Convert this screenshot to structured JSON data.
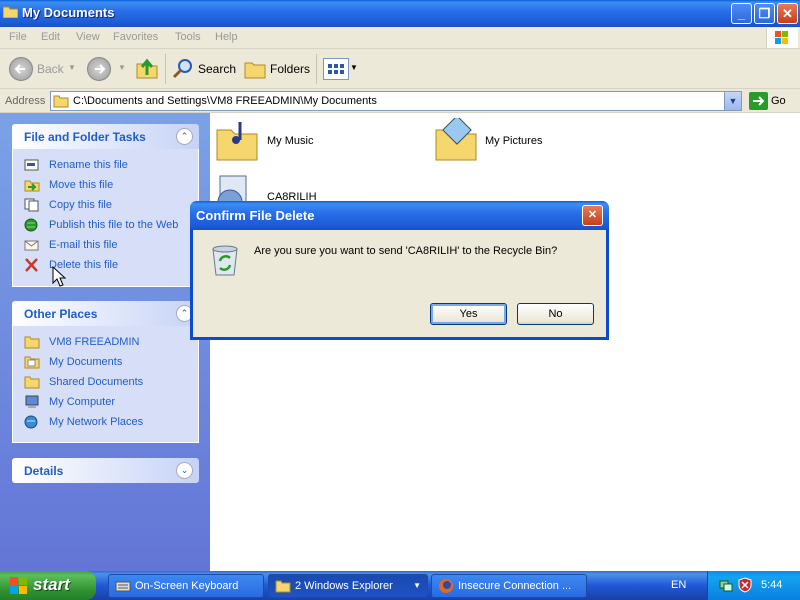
{
  "window": {
    "title": "My Documents"
  },
  "menubar": {
    "items": [
      "File",
      "Edit",
      "View",
      "Favorites",
      "Tools",
      "Help"
    ]
  },
  "toolbar": {
    "back_label": "Back",
    "search_label": "Search",
    "folders_label": "Folders"
  },
  "address": {
    "label": "Address",
    "value": "C:\\Documents and Settings\\VM8 FREEADMIN\\My Documents",
    "go_label": "Go"
  },
  "left_pane": {
    "file_tasks": {
      "title": "File and Folder Tasks",
      "items": [
        {
          "label": "Rename this file",
          "icon": "rename-icon"
        },
        {
          "label": "Move this file",
          "icon": "move-icon"
        },
        {
          "label": "Copy this file",
          "icon": "copy-icon"
        },
        {
          "label": "Publish this file to the Web",
          "icon": "publish-web-icon"
        },
        {
          "label": "E-mail this file",
          "icon": "email-icon"
        },
        {
          "label": "Delete this file",
          "icon": "delete-icon"
        }
      ]
    },
    "other_places": {
      "title": "Other Places",
      "items": [
        {
          "label": "VM8 FREEADMIN",
          "icon": "folder-icon"
        },
        {
          "label": "My Documents",
          "icon": "my-documents-icon"
        },
        {
          "label": "Shared Documents",
          "icon": "folder-icon"
        },
        {
          "label": "My Computer",
          "icon": "my-computer-icon"
        },
        {
          "label": "My Network Places",
          "icon": "network-places-icon"
        }
      ]
    },
    "details": {
      "title": "Details"
    }
  },
  "files": [
    {
      "label": "My Music",
      "icon": "music-folder-icon"
    },
    {
      "label": "My Pictures",
      "icon": "pictures-folder-icon"
    },
    {
      "label": "CA8RILIH",
      "icon": "file-icon"
    }
  ],
  "dialog": {
    "title": "Confirm File Delete",
    "message": "Are you sure you want to send 'CA8RILIH' to the Recycle Bin?",
    "yes_label": "Yes",
    "no_label": "No"
  },
  "taskbar": {
    "start_label": "start",
    "buttons": [
      {
        "label": "On-Screen Keyboard",
        "icon": "keyboard-icon"
      },
      {
        "label": "2 Windows Explorer",
        "icon": "folder-icon"
      },
      {
        "label": "Insecure Connection ...",
        "icon": "firefox-icon"
      }
    ],
    "language": "EN",
    "clock": "5:44"
  }
}
